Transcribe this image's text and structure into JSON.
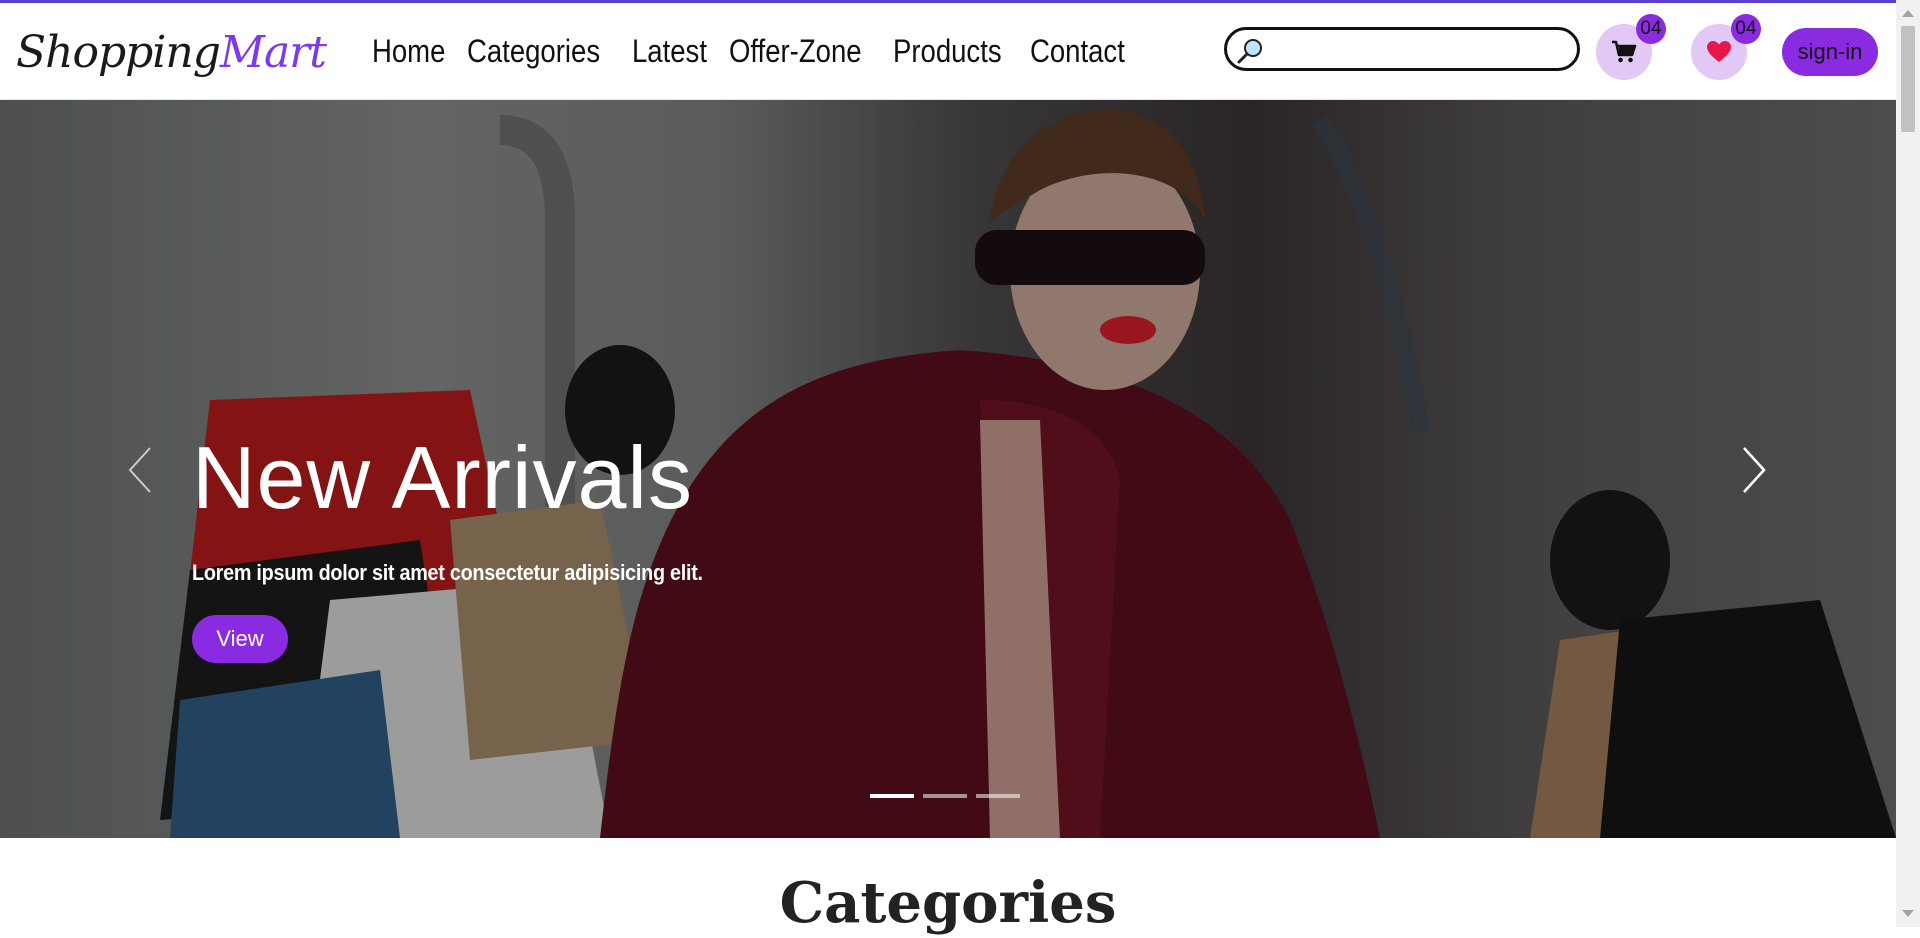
{
  "logo": {
    "part1": "Shopping",
    "part2": "Mart"
  },
  "nav": [
    {
      "label": "Home"
    },
    {
      "label": "Categories"
    },
    {
      "label": "Latest"
    },
    {
      "label": "Offer-Zone"
    },
    {
      "label": "Products"
    },
    {
      "label": "Contact"
    }
  ],
  "search": {
    "value": "",
    "icon": "magnifier-icon"
  },
  "cart": {
    "count": "04",
    "icon": "cart-icon"
  },
  "wishlist": {
    "count": "04",
    "icon": "heart-icon"
  },
  "signin": {
    "label": "sign-in"
  },
  "hero": {
    "title": "New Arrivals",
    "text": "Lorem ipsum dolor sit amet consectetur adipisicing elit.",
    "button": "View",
    "slides": 3,
    "active_slide": 1
  },
  "section": {
    "title": "Categories"
  },
  "colors": {
    "accent": "#8a2be2",
    "accent_light": "#e2c8f7",
    "topline": "#5a3fd0",
    "heart": "#e8174a"
  }
}
